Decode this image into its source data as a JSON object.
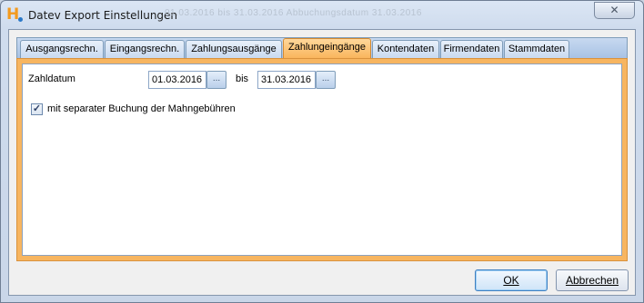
{
  "window": {
    "title": "Datev Export Einstellungen",
    "close_glyph": "✕",
    "logo_letter": "H",
    "background_ghost_text": "01.03.2016   bis   31.03.2016        Abbuchungsdatum                 31.03.2016"
  },
  "tabs": [
    {
      "label": "Ausgangsrechn.",
      "active": false
    },
    {
      "label": "Eingangsrechn.",
      "active": false
    },
    {
      "label": "Zahlungsausgänge",
      "active": false
    },
    {
      "label": "Zahlungeingänge",
      "active": true
    },
    {
      "label": "Kontendaten",
      "active": false
    },
    {
      "label": "Firmendaten",
      "active": false
    },
    {
      "label": "Stammdaten",
      "active": false
    }
  ],
  "form": {
    "zahldatum_label": "Zahldatum",
    "from_date": "01.03.2016",
    "to_label": "bis",
    "to_date": "31.03.2016",
    "date_button_glyph": "...",
    "checkbox_checked": true,
    "checkbox_mark": "✓",
    "checkbox_label": "mit separater Buchung der Mahngebühren"
  },
  "buttons": {
    "ok_label": "OK",
    "cancel_label": "Abbrechen"
  },
  "colors": {
    "active_tab": "#f9b45a",
    "panel_frame": "#f7b560",
    "accent_blue": "#3f7fc0"
  }
}
